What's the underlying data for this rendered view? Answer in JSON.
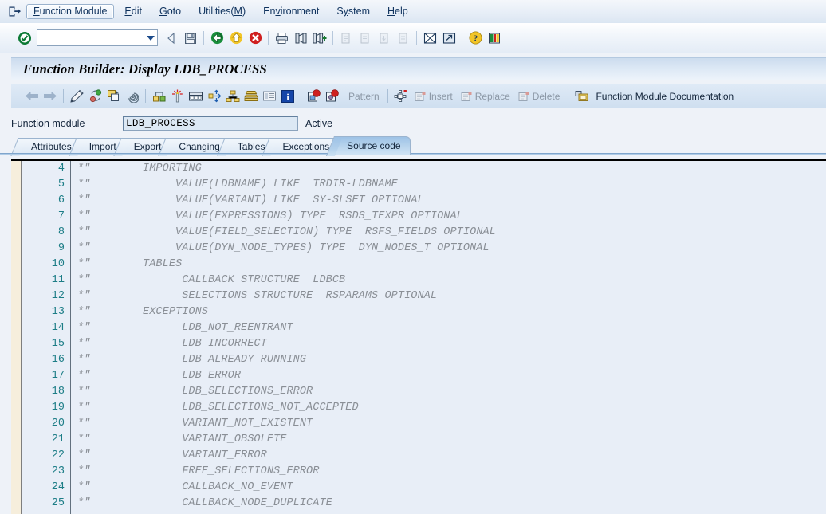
{
  "menubar": {
    "exit_icon": "exit-box-arrow-icon",
    "items": [
      {
        "label": "Function Module",
        "accel": "F",
        "focused": true
      },
      {
        "label": "Edit",
        "accel": "E",
        "focused": false
      },
      {
        "label": "Goto",
        "accel": "G",
        "focused": false
      },
      {
        "label": "Utilities(M)",
        "accel": "M",
        "focused": false
      },
      {
        "label": "Environment",
        "accel": "v",
        "focused": false
      },
      {
        "label": "System",
        "accel": "y",
        "focused": false
      },
      {
        "label": "Help",
        "accel": "H",
        "focused": false
      }
    ]
  },
  "system_toolbar": {
    "command_field_value": "",
    "command_field_placeholder": "",
    "icons": [
      "enter-check-icon",
      "back-arrow-icon",
      "save-disk-icon",
      "back-green-icon",
      "exit-yellow-icon",
      "cancel-red-icon",
      "print-icon",
      "find-icon",
      "find-next-icon",
      "first-page-icon",
      "previous-page-icon",
      "next-page-icon",
      "last-page-icon",
      "create-session-icon",
      "create-shortcut-icon",
      "help-icon",
      "layout-menu-icon"
    ]
  },
  "title": "Function Builder: Display LDB_PROCESS",
  "app_toolbar": {
    "icons": [
      "back-arrow-icon",
      "forward-arrow-icon",
      "check-syntax-pencil-icon",
      "activate-icon",
      "copy-object-icon",
      "where-used-spiral-icon",
      "navigate-object-icon",
      "new-magic-wand-icon",
      "display-object-icon",
      "expand-icon",
      "hierarchy-icon",
      "stack-icon",
      "list-icon",
      "info-blue-icon",
      "breakpoint-icon",
      "watchpoint-icon"
    ],
    "buttons": [
      {
        "label": "Pattern",
        "icon": "pattern-icon",
        "enabled": false
      },
      {
        "label": "Insert",
        "icon": "insert-icon",
        "enabled": false
      },
      {
        "label": "Replace",
        "icon": "replace-icon",
        "enabled": false
      },
      {
        "label": "Delete",
        "icon": "delete-icon",
        "enabled": false
      },
      {
        "label": "Function Module Documentation",
        "icon": "documentation-icon",
        "enabled": true
      }
    ]
  },
  "function_module_row": {
    "label": "Function module",
    "value": "LDB_PROCESS",
    "placeholder": "",
    "status": "Active"
  },
  "tabs": [
    {
      "label": "Attributes",
      "active": false
    },
    {
      "label": "Import",
      "active": false
    },
    {
      "label": "Export",
      "active": false
    },
    {
      "label": "Changing",
      "active": false
    },
    {
      "label": "Tables",
      "active": false
    },
    {
      "label": "Exceptions",
      "active": false
    },
    {
      "label": "Source code",
      "active": true
    }
  ],
  "editor": {
    "first_visible_line": 4,
    "colors": {
      "background": "#e8eef7",
      "line_number": "#1c7d86",
      "comment_text": "#8a8f96",
      "marker_gutter": "#f6eedc"
    },
    "lines": [
      {
        "n": "4",
        "text": "*\"        IMPORTING"
      },
      {
        "n": "5",
        "text": "*\"             VALUE(LDBNAME) LIKE  TRDIR-LDBNAME"
      },
      {
        "n": "6",
        "text": "*\"             VALUE(VARIANT) LIKE  SY-SLSET OPTIONAL"
      },
      {
        "n": "7",
        "text": "*\"             VALUE(EXPRESSIONS) TYPE  RSDS_TEXPR OPTIONAL"
      },
      {
        "n": "8",
        "text": "*\"             VALUE(FIELD_SELECTION) TYPE  RSFS_FIELDS OPTIONAL"
      },
      {
        "n": "9",
        "text": "*\"             VALUE(DYN_NODE_TYPES) TYPE  DYN_NODES_T OPTIONAL"
      },
      {
        "n": "10",
        "text": "*\"        TABLES"
      },
      {
        "n": "11",
        "text": "*\"              CALLBACK STRUCTURE  LDBCB"
      },
      {
        "n": "12",
        "text": "*\"              SELECTIONS STRUCTURE  RSPARAMS OPTIONAL"
      },
      {
        "n": "13",
        "text": "*\"        EXCEPTIONS"
      },
      {
        "n": "14",
        "text": "*\"              LDB_NOT_REENTRANT"
      },
      {
        "n": "15",
        "text": "*\"              LDB_INCORRECT"
      },
      {
        "n": "16",
        "text": "*\"              LDB_ALREADY_RUNNING"
      },
      {
        "n": "17",
        "text": "*\"              LDB_ERROR"
      },
      {
        "n": "18",
        "text": "*\"              LDB_SELECTIONS_ERROR"
      },
      {
        "n": "19",
        "text": "*\"              LDB_SELECTIONS_NOT_ACCEPTED"
      },
      {
        "n": "20",
        "text": "*\"              VARIANT_NOT_EXISTENT"
      },
      {
        "n": "21",
        "text": "*\"              VARIANT_OBSOLETE"
      },
      {
        "n": "22",
        "text": "*\"              VARIANT_ERROR"
      },
      {
        "n": "23",
        "text": "*\"              FREE_SELECTIONS_ERROR"
      },
      {
        "n": "24",
        "text": "*\"              CALLBACK_NO_EVENT"
      },
      {
        "n": "25",
        "text": "*\"              CALLBACK_NODE_DUPLICATE"
      }
    ]
  }
}
